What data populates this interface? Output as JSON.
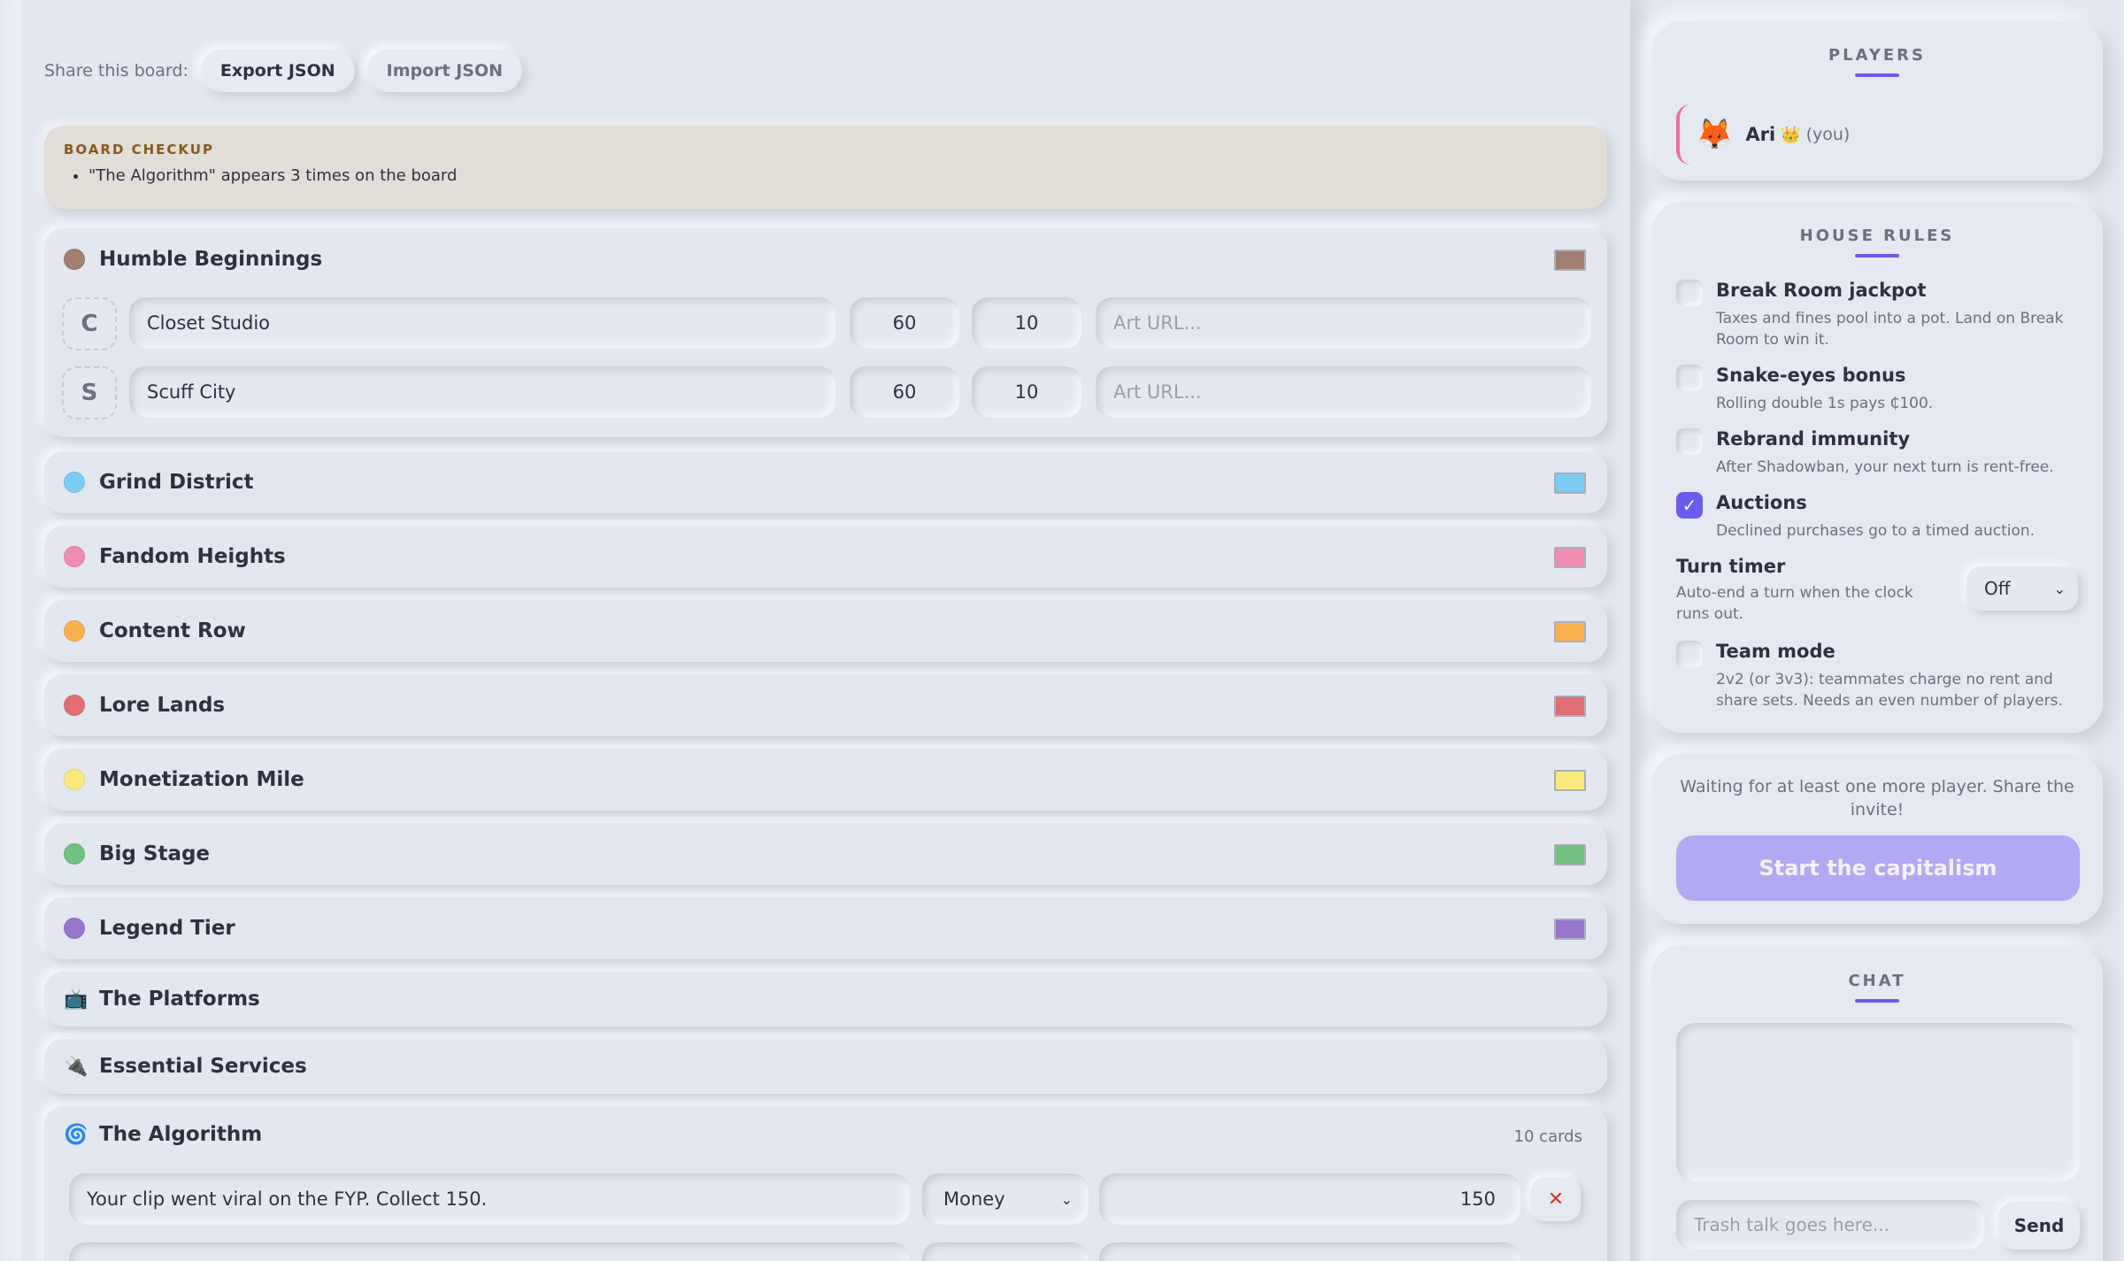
{
  "share": {
    "label": "Share this board:",
    "export_label": "Export JSON",
    "import_label": "Import JSON"
  },
  "checkup": {
    "title": "BOARD CHECKUP",
    "items": [
      "\"The Algorithm\" appears 3 times on the board"
    ]
  },
  "groups": [
    {
      "name": "Humble Beginnings",
      "color": "#a47e6e"
    },
    {
      "name": "Grind District",
      "color": "#7ccdf3"
    },
    {
      "name": "Fandom Heights",
      "color": "#f28bb1"
    },
    {
      "name": "Content Row",
      "color": "#f8b14a"
    },
    {
      "name": "Lore Lands",
      "color": "#e46d72"
    },
    {
      "name": "Monetization Mile",
      "color": "#fbe97a"
    },
    {
      "name": "Big Stage",
      "color": "#72c17f"
    },
    {
      "name": "Legend Tier",
      "color": "#9a76cf"
    }
  ],
  "properties": [
    {
      "letter": "C",
      "name": "Closet Studio",
      "price": "60",
      "rent": "10",
      "art_placeholder": "Art URL..."
    },
    {
      "letter": "S",
      "name": "Scuff City",
      "price": "60",
      "rent": "10",
      "art_placeholder": "Art URL..."
    }
  ],
  "specials": [
    {
      "icon": "📺",
      "name": "The Platforms"
    },
    {
      "icon": "🔌",
      "name": "Essential Services"
    }
  ],
  "algorithm": {
    "icon": "🌀",
    "name": "The Algorithm",
    "count": "10 cards",
    "card": {
      "text": "Your clip went viral on the FYP. Collect 150.",
      "type": "Money",
      "amount": "150",
      "remove": "✕"
    }
  },
  "players": {
    "title": "PLAYERS",
    "list": [
      {
        "emoji": "🦊",
        "name": "Ari",
        "crown": "👑",
        "tag": "(you)"
      }
    ]
  },
  "house_rules": {
    "title": "HOUSE RULES",
    "rules": [
      {
        "name": "Break Room jackpot",
        "desc": "Taxes and fines pool into a pot. Land on Break Room to win it.",
        "checked": false
      },
      {
        "name": "Snake-eyes bonus",
        "desc": "Rolling double 1s pays ₵100.",
        "checked": false
      },
      {
        "name": "Rebrand immunity",
        "desc": "After Shadowban, your next turn is rent-free.",
        "checked": false
      },
      {
        "name": "Auctions",
        "desc": "Declined purchases go to a timed auction.",
        "checked": true
      }
    ],
    "timer": {
      "title": "Turn timer",
      "desc": "Auto-end a turn when the clock runs out.",
      "value": "Off"
    },
    "team": {
      "name": "Team mode",
      "desc": "2v2 (or 3v3): teammates charge no rent and share sets. Needs an even number of players.",
      "checked": false
    },
    "check_mark": "✓"
  },
  "lobby": {
    "waiting": "Waiting for at least one more player. Share the invite!",
    "start_label": "Start the capitalism"
  },
  "chat": {
    "title": "CHAT",
    "placeholder": "Trash talk goes here...",
    "send_label": "Send"
  }
}
